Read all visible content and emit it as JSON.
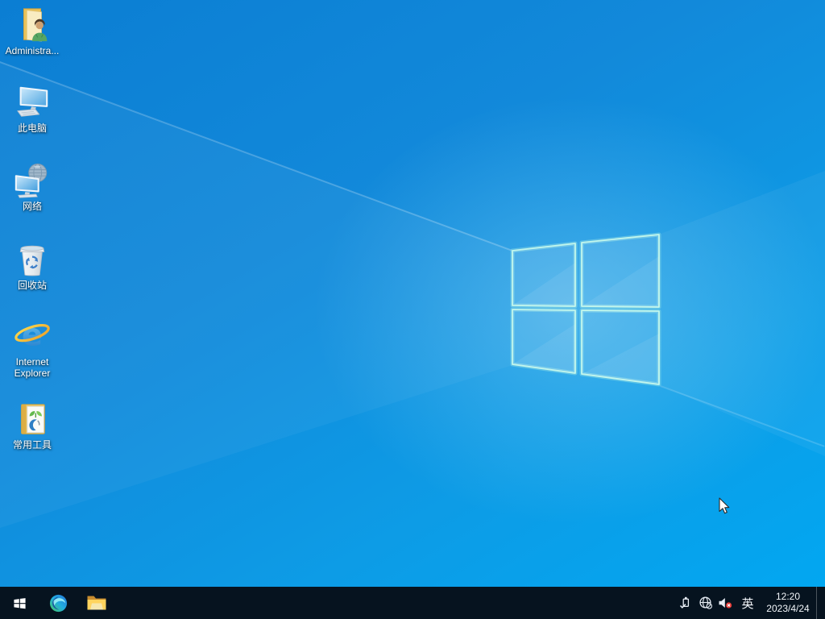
{
  "desktop": {
    "icons": [
      {
        "id": "administrator",
        "label": "Administra..."
      },
      {
        "id": "this-pc",
        "label": "此电脑"
      },
      {
        "id": "network",
        "label": "网络"
      },
      {
        "id": "recycle-bin",
        "label": "回收站"
      },
      {
        "id": "internet-explorer",
        "label": "Internet Explorer"
      },
      {
        "id": "common-tools",
        "label": "常用工具"
      }
    ]
  },
  "taskbar": {
    "tray": {
      "ime": "英",
      "time": "12:20",
      "date": "2023/4/24"
    }
  },
  "colors": {
    "wallpaper_top": "#0b7ed3",
    "wallpaper_bottom": "#02a7f1",
    "taskbar": "#06131f",
    "logo_edge": "#c2f7ec",
    "mute_badge": "#e53935"
  }
}
